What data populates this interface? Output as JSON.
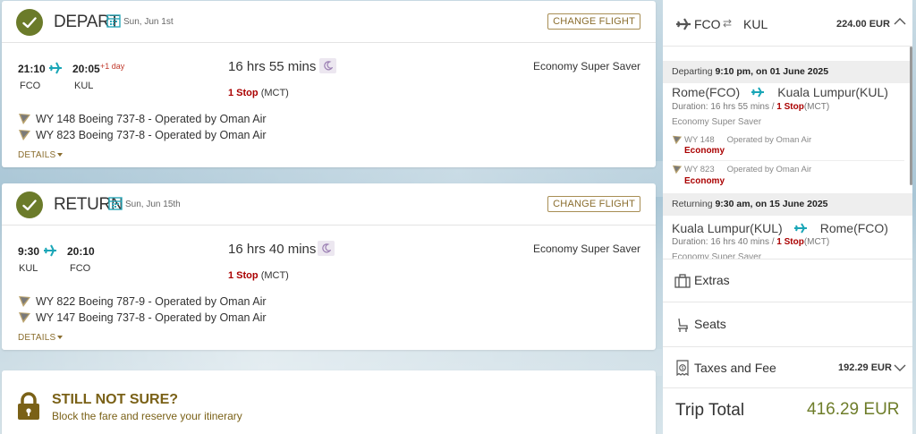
{
  "depart": {
    "title": "DEPART",
    "date": "Sun, Jun 1st",
    "change_label": "CHANGE FLIGHT",
    "dep_time": "21:10",
    "dep_code": "FCO",
    "arr_time": "20:05",
    "arr_code": "KUL",
    "plus_day": "+1 day",
    "duration": "16 hrs 55 mins",
    "stops": "1 Stop",
    "via": "(MCT)",
    "cabin": "Economy Super Saver",
    "flights": [
      "WY 148 Boeing 737-8 - Operated by Oman Air",
      "WY 823 Boeing 737-8 - Operated by Oman Air"
    ],
    "details_label": "DETAILS"
  },
  "return": {
    "title": "RETURN",
    "date": "Sun, Jun 15th",
    "change_label": "CHANGE FLIGHT",
    "dep_time": "9:30",
    "dep_code": "KUL",
    "arr_time": "20:10",
    "arr_code": "FCO",
    "duration": "16 hrs 40 mins",
    "stops": "1 Stop",
    "via": "(MCT)",
    "cabin": "Economy Super Saver",
    "flights": [
      "WY 822 Boeing 787-9 - Operated by Oman Air",
      "WY 147 Boeing 737-8 - Operated by Oman Air"
    ],
    "details_label": "DETAILS"
  },
  "not_sure": {
    "title": "STILL NOT SURE?",
    "subtitle": "Block the fare and reserve your itinerary"
  },
  "summary": {
    "from": "FCO",
    "swap": "⇄",
    "to": "KUL",
    "price": "224.00 EUR",
    "departing": {
      "label": "Departing",
      "when": "9:10 pm, on 01 June 2025",
      "from": "Rome(FCO)",
      "to": "Kuala Lumpur(KUL)",
      "duration_prefix": "Duration: 16 hrs 55 mins /",
      "stops": "1 Stop",
      "via": "(MCT)",
      "cabin": "Economy Super Saver",
      "segments": [
        {
          "flight": "WY 148",
          "operator": "Operated by Oman Air",
          "class": "Economy"
        },
        {
          "flight": "WY 823",
          "operator": "Operated by Oman Air",
          "class": "Economy"
        }
      ]
    },
    "returning": {
      "label": "Returning",
      "when": "9:30 am, on 15 June 2025",
      "from": "Kuala Lumpur(KUL)",
      "to": "Rome(FCO)",
      "duration_prefix": "Duration: 16 hrs 40 mins /",
      "stops": "1 Stop",
      "via": "(MCT)",
      "cabin": "Economy Super Saver"
    },
    "extras_label": "Extras",
    "seats_label": "Seats",
    "taxes_label": "Taxes and Fee",
    "taxes_value": "192.29 EUR",
    "trip_total_label": "Trip Total",
    "trip_total_value": "416.29 EUR"
  },
  "colors": {
    "accent_olive": "#6b7b2a",
    "accent_gold": "#8a6d2e",
    "stop_red": "#aa0000",
    "plane_teal": "#1aa6b7"
  }
}
